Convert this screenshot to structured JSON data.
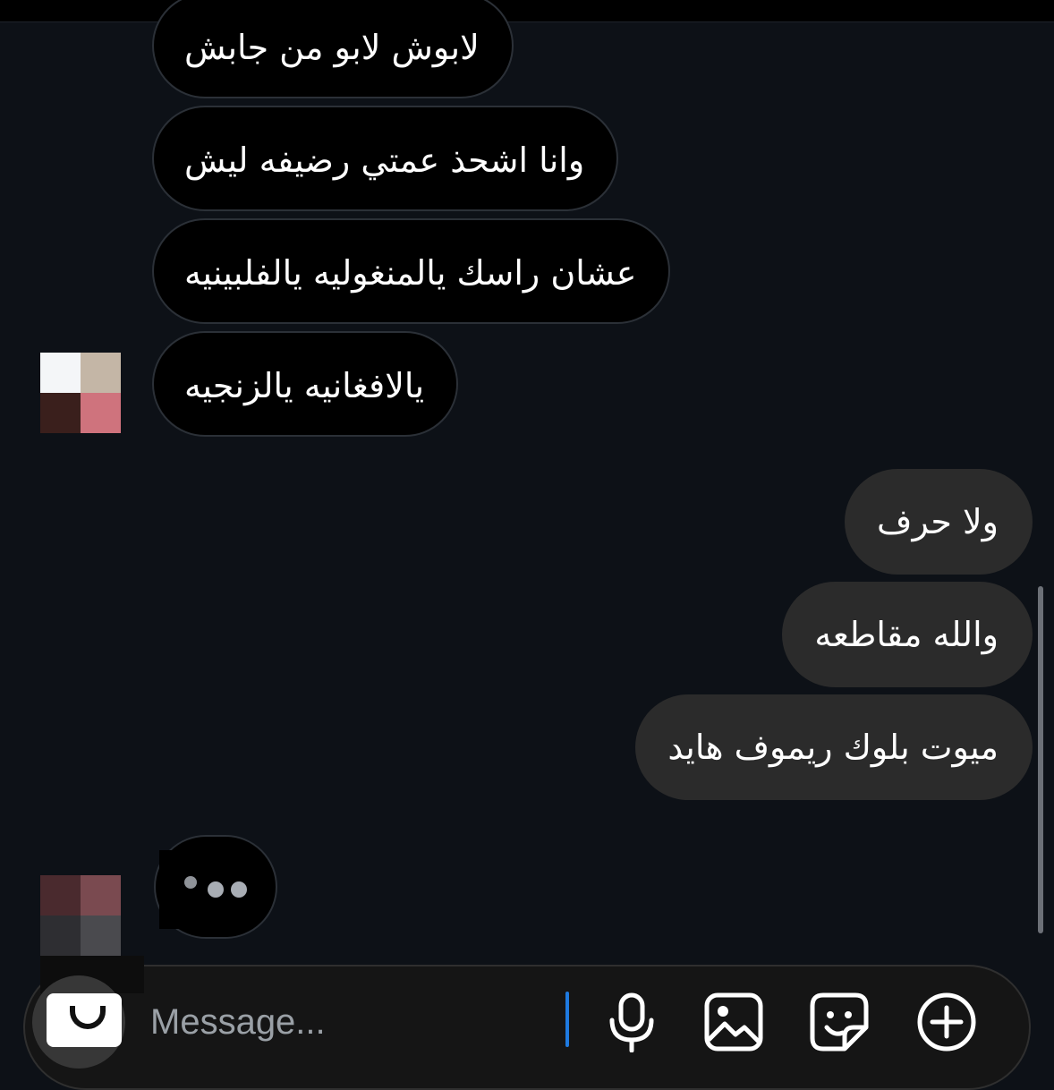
{
  "conversation": {
    "received_messages": [
      "لابوش لابو من جابش",
      "وانا اشحذ عمتي رضيفه ليش",
      "عشان راسك يالمنغوليه يالفلبينيه",
      "يالافغانيه يالزنجيه"
    ],
    "sent_messages": [
      "ولا حرف",
      "والله مقاطعه",
      "ميوت بلوك ريموف هايد"
    ],
    "typing_indicator": "typing"
  },
  "composer": {
    "placeholder": "Message...",
    "icons": [
      "camera-icon",
      "microphone-icon",
      "gallery-icon",
      "sticker-icon",
      "add-icon"
    ]
  },
  "colors": {
    "background": "#0d1117",
    "received_bubble": "#000000",
    "sent_bubble": "#2b2b2b",
    "caret": "#1f7ae0"
  }
}
